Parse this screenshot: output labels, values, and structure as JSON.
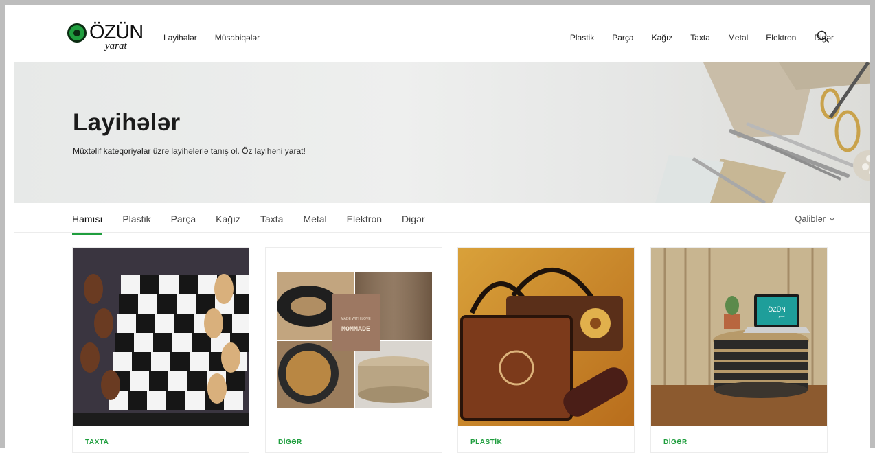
{
  "brand": {
    "name": "ÖZÜN",
    "subtitle": "yarat"
  },
  "nav": {
    "left": [
      "Layihələr",
      "Müsabiqələr"
    ],
    "right": [
      "Plastik",
      "Parça",
      "Kağız",
      "Taxta",
      "Metal",
      "Elektron",
      "Digər"
    ],
    "search_icon": "search-icon"
  },
  "hero": {
    "title": "Layihələr",
    "subtitle": "Müxtəlif kateqoriyalar üzrə layihələrlə tanış ol. Öz layihəni yarat!"
  },
  "tabs": {
    "items": [
      "Hamısı",
      "Plastik",
      "Parça",
      "Kağız",
      "Taxta",
      "Metal",
      "Elektron",
      "Digər"
    ],
    "active": "Hamısı",
    "templates_label": "Qaliblər",
    "templates_icon": "chevron-down-icon"
  },
  "cards": [
    {
      "category": "TAXTA",
      "image": "chess-board-image"
    },
    {
      "category": "DİGƏR",
      "image": "tire-table-collage-image",
      "image_text": [
        "MADE WITH LOVE",
        "MOMMADE"
      ]
    },
    {
      "category": "PLASTİK",
      "image": "bags-image"
    },
    {
      "category": "DİGƏR",
      "image": "cardboard-table-image",
      "screen_text": [
        "ÖZÜN",
        "yarat"
      ]
    }
  ],
  "colors": {
    "accent": "#1f9e3e",
    "frame": "#bdbdbd"
  }
}
